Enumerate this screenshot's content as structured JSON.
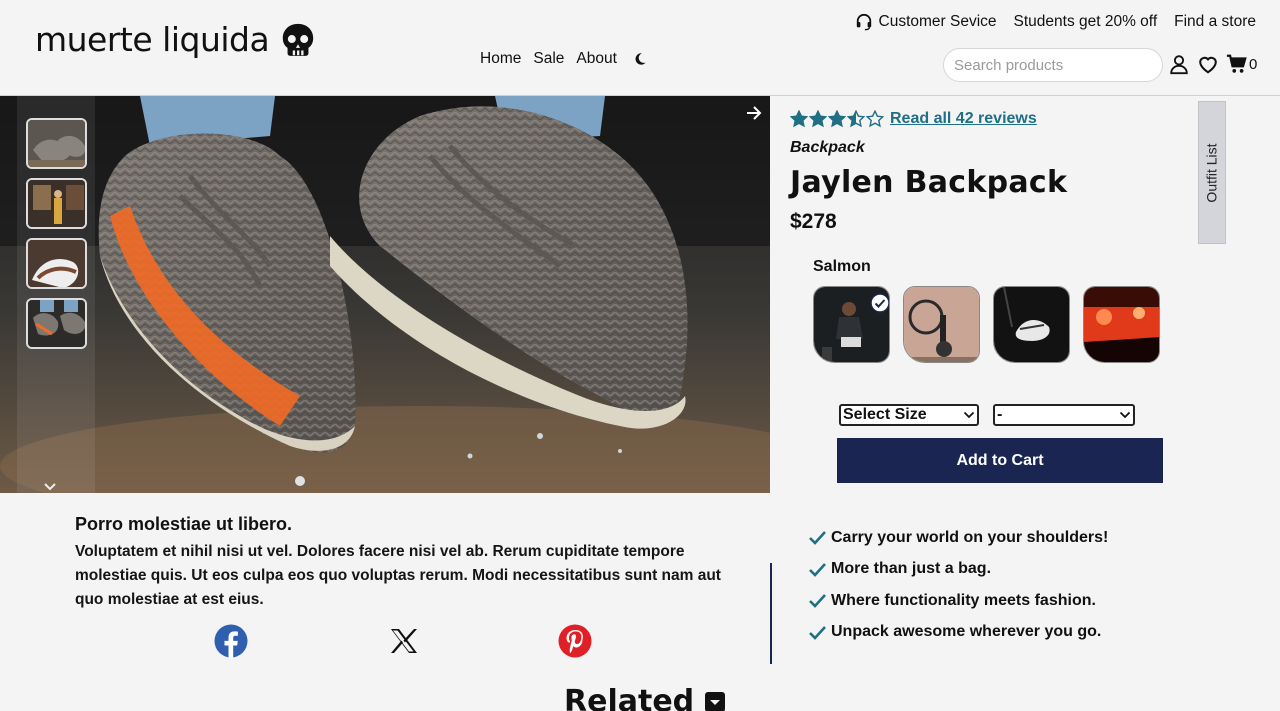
{
  "brand": {
    "name": "muerte liquida",
    "logo_icon": "skull-icon"
  },
  "top_links": {
    "customer_service": "Customer Sevice",
    "students": "Students get 20% off",
    "find_store": "Find a store"
  },
  "nav": {
    "home": "Home",
    "sale": "Sale",
    "about": "About",
    "theme_icon": "moon-icon"
  },
  "search": {
    "placeholder": "Search products"
  },
  "cart": {
    "count": "0"
  },
  "product": {
    "rating": 3.5,
    "rating_max": 5,
    "reviews_link": "Read all 42 reviews",
    "category": "Backpack",
    "name": "Jaylen Backpack",
    "price": "$278",
    "selected_style": "Salmon",
    "size_select": "Select Size",
    "qty_select": "-",
    "add_to_cart": "Add to Cart"
  },
  "outfit_tab": "Outfit List",
  "description": {
    "title": "Porro molestiae ut libero.",
    "body": "Voluptatem et nihil nisi ut vel. Dolores facere nisi vel ab. Rerum cupiditate tempore molestiae quis. Ut eos culpa eos quo voluptas rerum. Modi necessitatibus sunt nam aut quo molestiae at est eius."
  },
  "share_icons": [
    "facebook-icon",
    "x-icon",
    "pinterest-icon"
  ],
  "features": [
    "Carry your world on your shoulders!",
    "More than just a bag.",
    "Where functionality meets fashion.",
    "Unpack awesome wherever you go."
  ],
  "related": {
    "title": "Related"
  },
  "colors": {
    "accent_link": "#1f6f85",
    "button": "#1b2552",
    "star": "#1f6f85",
    "check": "#1f6f85"
  }
}
